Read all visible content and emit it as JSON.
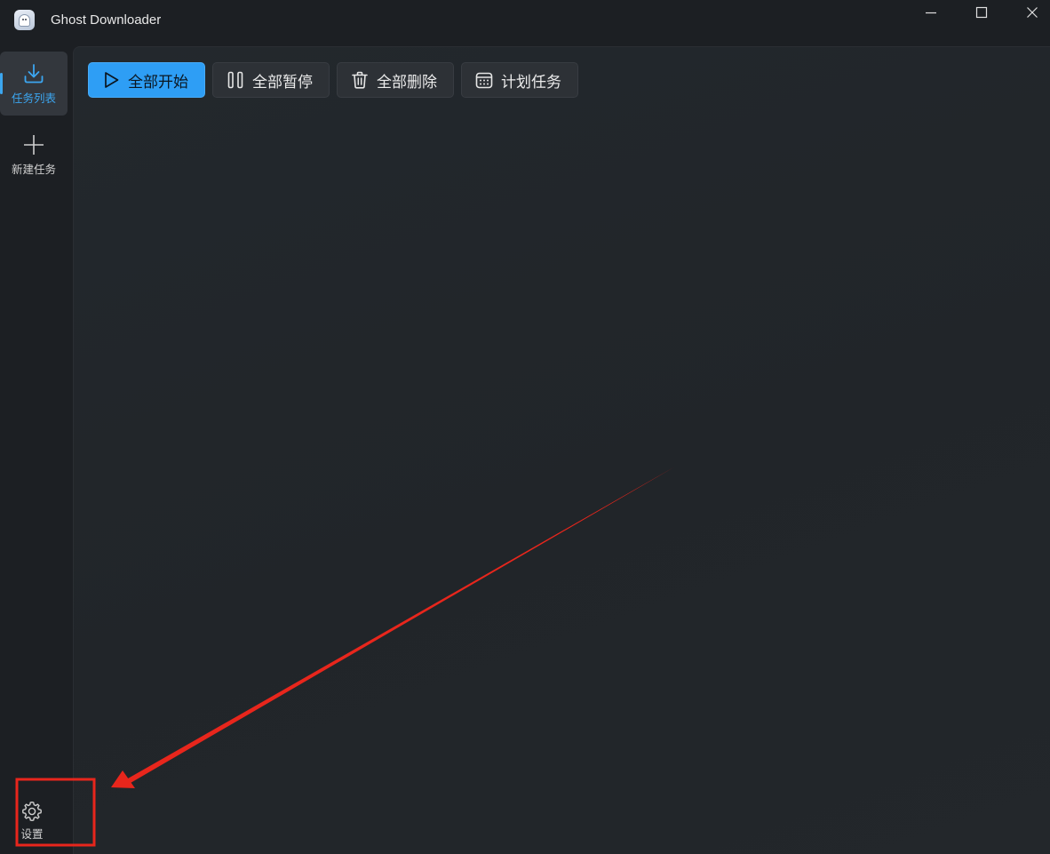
{
  "window": {
    "title": "Ghost Downloader",
    "controls": [
      "minimize",
      "maximize",
      "close"
    ]
  },
  "sidebar": {
    "items": [
      {
        "label": "任务列表",
        "icon": "download-icon",
        "active": true
      },
      {
        "label": "新建任务",
        "icon": "plus-icon",
        "active": false
      }
    ],
    "footer": {
      "label": "设置",
      "icon": "gear-icon"
    }
  },
  "toolbar": {
    "start_all": "全部开始",
    "pause_all": "全部暂停",
    "delete_all": "全部删除",
    "schedule": "计划任务"
  },
  "colors": {
    "accent": "#2e9ef5",
    "annotation": "#e8261c",
    "background": "#212529"
  }
}
